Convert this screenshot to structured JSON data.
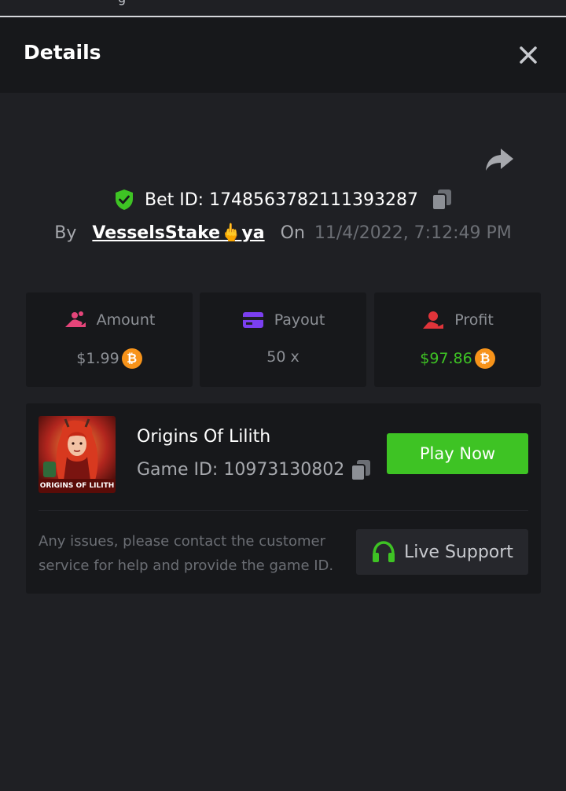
{
  "modal": {
    "title": "Details"
  },
  "bet": {
    "bet_id": "Bet ID: 1748563782111393287",
    "by_label": "By",
    "username": "VesselsStake🖕ya",
    "on_label": "On",
    "datetime": "11/4/2022, 7:12:49 PM"
  },
  "stats": [
    {
      "label": "Amount",
      "value": "$1.99",
      "icon": "hand-coins-icon",
      "currency": "bitcoin-icon"
    },
    {
      "label": "Payout",
      "value": "50 x",
      "icon": "card-icon"
    },
    {
      "label": "Profit",
      "value": "$97.86",
      "icon": "hand-money-icon",
      "currency": "bitcoin-icon"
    }
  ],
  "game": {
    "name": "Origins Of Lilith",
    "game_id": "Game ID: 10973130802",
    "thumbnail_text": "ORIGINS OF LILITH",
    "play_label": "Play Now",
    "issues_text": "Any issues, please contact the customer service for help and provide the game ID.",
    "support_label": "Live Support"
  },
  "colors": {
    "accent_green": "#3ec324",
    "amount_icon": "#e5457a",
    "payout_icon": "#7b3ff0",
    "profit_icon": "#e0343a",
    "bitcoin": "#f7931a",
    "modal_bg": "#1f2024",
    "panel_bg": "#17181b"
  }
}
